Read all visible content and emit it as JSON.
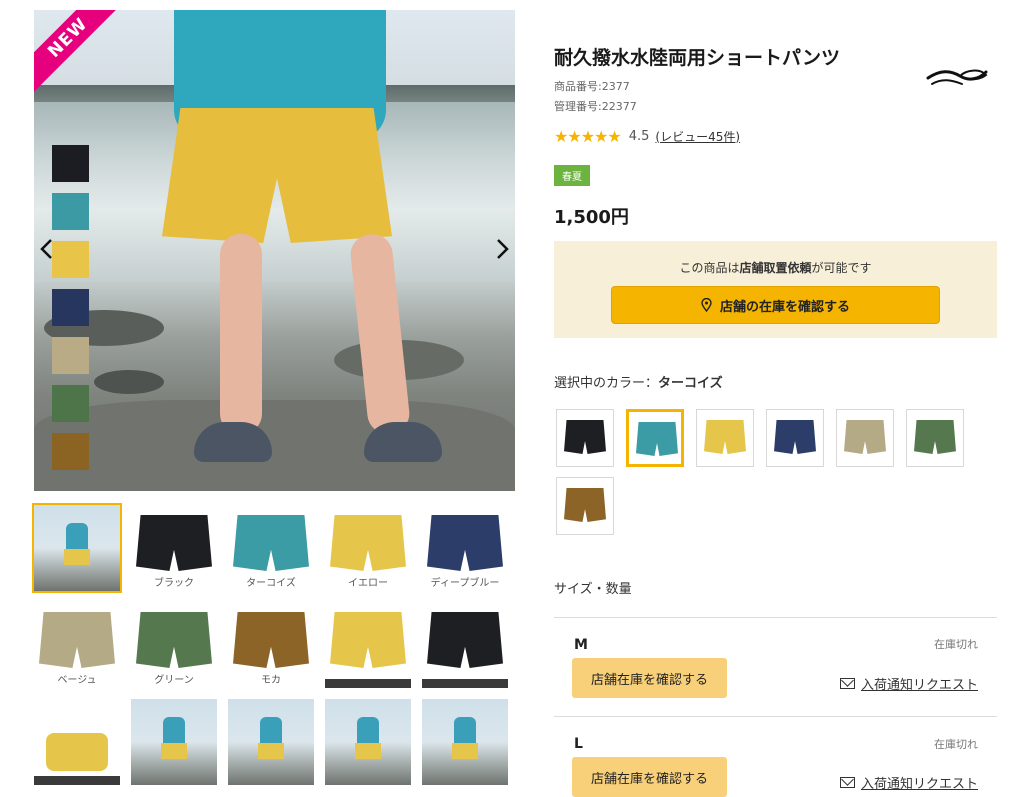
{
  "gallery": {
    "new_badge": "NEW",
    "prev_icon": "chevron-left-icon",
    "next_icon": "chevron-right-icon",
    "mini_swatch_colors": [
      "#1b1d22",
      "#3b9aa3",
      "#e8c548",
      "#27365e",
      "#b8ab86",
      "#4e7449",
      "#8b6322"
    ],
    "thumbnails": [
      {
        "label": "",
        "kind": "photo",
        "selected": true
      },
      {
        "label": "ブラック",
        "kind": "shorts",
        "color": "#1e1f23"
      },
      {
        "label": "ターコイズ",
        "kind": "shorts",
        "color": "#3c9ca5"
      },
      {
        "label": "イエロー",
        "kind": "shorts",
        "color": "#e6c64a"
      },
      {
        "label": "ディープブルー",
        "kind": "shorts",
        "color": "#2c3d69"
      },
      {
        "label": "ベージュ",
        "kind": "shorts",
        "color": "#b5aa86"
      },
      {
        "label": "グリーン",
        "kind": "shorts",
        "color": "#55784f"
      },
      {
        "label": "モカ",
        "kind": "shorts",
        "color": "#8d6427"
      },
      {
        "label": "",
        "kind": "shorts-detail",
        "color": "#e6c64a"
      },
      {
        "label": "",
        "kind": "shorts-detail",
        "color": "#1e1f23"
      },
      {
        "label": "",
        "kind": "pack",
        "color": "#e6c64a"
      },
      {
        "label": "",
        "kind": "photo"
      },
      {
        "label": "",
        "kind": "photo"
      },
      {
        "label": "",
        "kind": "photo"
      },
      {
        "label": "",
        "kind": "photo"
      }
    ]
  },
  "product": {
    "title": "耐久撥水水陸両用ショートパンツ",
    "product_number": "商品番号:2377",
    "management_number": "管理番号:22377",
    "rating_stars": "★★★★★",
    "rating_score": "4.5",
    "review_link": "(レビュー45件)",
    "season_tag": "春夏",
    "price": "1,500円"
  },
  "pickup": {
    "text_before": "この商品は",
    "text_bold": "店舗取置依頼",
    "text_after": "が可能です",
    "button_label": "店舗の在庫を確認する",
    "button_icon": "map-pin-icon"
  },
  "color": {
    "label": "選択中のカラー：",
    "selected_name": "ターコイズ",
    "swatches": [
      {
        "color": "#1e1f23"
      },
      {
        "color": "#3c9ca5",
        "selected": true
      },
      {
        "color": "#e6c64a"
      },
      {
        "color": "#2c3d69"
      },
      {
        "color": "#b5aa86"
      },
      {
        "color": "#55784f"
      },
      {
        "color": "#8d6427"
      }
    ]
  },
  "sizes": {
    "title": "サイズ・数量",
    "items": [
      {
        "name": "M",
        "stock": "在庫切れ",
        "store_button": "店舗在庫を確認する",
        "notify_link": "入荷通知リクエスト"
      },
      {
        "name": "L",
        "stock": "在庫切れ",
        "store_button": "店舗在庫を確認する",
        "notify_link": "入荷通知リクエスト"
      }
    ]
  },
  "accent_color": "#f5b400"
}
